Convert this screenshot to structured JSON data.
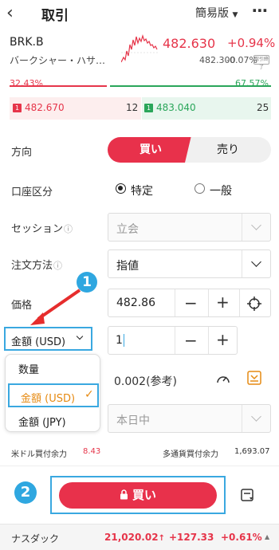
{
  "header": {
    "back_icon": "chevron-left-icon",
    "title": "取引",
    "mode_label": "簡易版",
    "more_icon": "ellipsis-icon"
  },
  "stock": {
    "ticker": "BRK.B",
    "name": "バークシャー・ハサ…",
    "price": "482.630",
    "change_pct": "+0.94%",
    "prev_close": "482.300",
    "sub_change": "-0.07%",
    "tag": "取引終了"
  },
  "book": {
    "bid_ratio": "32.43%",
    "ask_ratio": "67.57%",
    "bid_price": "482.670",
    "bid_qty": "12",
    "ask_price": "483.040",
    "ask_qty": "25",
    "bid_badge": "1",
    "ask_badge": "1"
  },
  "form": {
    "side_label": "方向",
    "buy_label": "買い",
    "sell_label": "売り",
    "account_label": "口座区分",
    "account_opt1": "特定",
    "account_opt2": "一般",
    "session_label": "セッション",
    "session_value": "立会",
    "order_method_label": "注文方法",
    "order_method_value": "指値",
    "price_label": "価格",
    "price_value": "482.86",
    "amount_selector": "金額 (USD)",
    "amount_value": "1",
    "estimate_value": "0.002(参考)",
    "expiry_value": "本日中"
  },
  "dropdown": {
    "items": [
      "数量",
      "金額 (USD)",
      "金額 (JPY)"
    ],
    "selected": "金額 (USD)"
  },
  "footer": {
    "usd_power_label": "米ドル買付余力",
    "usd_power_value": "8.43",
    "multi_power_label": "多通貨買付余力",
    "multi_power_value": "1,693.07",
    "buy_button": "買い",
    "lock_icon": "lock-icon",
    "list_icon": "list-icon"
  },
  "callouts": {
    "one": "1",
    "two": "2"
  },
  "index_bar": {
    "name": "ナスダック",
    "value": "21,020.02",
    "arrow": "↑",
    "change": "+127.33",
    "change_pct": "+0.61%"
  },
  "colors": {
    "buy": "#e8314b",
    "sell_green": "#2aa65a",
    "accent_blue": "#2fa7e0",
    "dropdown_selected": "#e68a12"
  }
}
